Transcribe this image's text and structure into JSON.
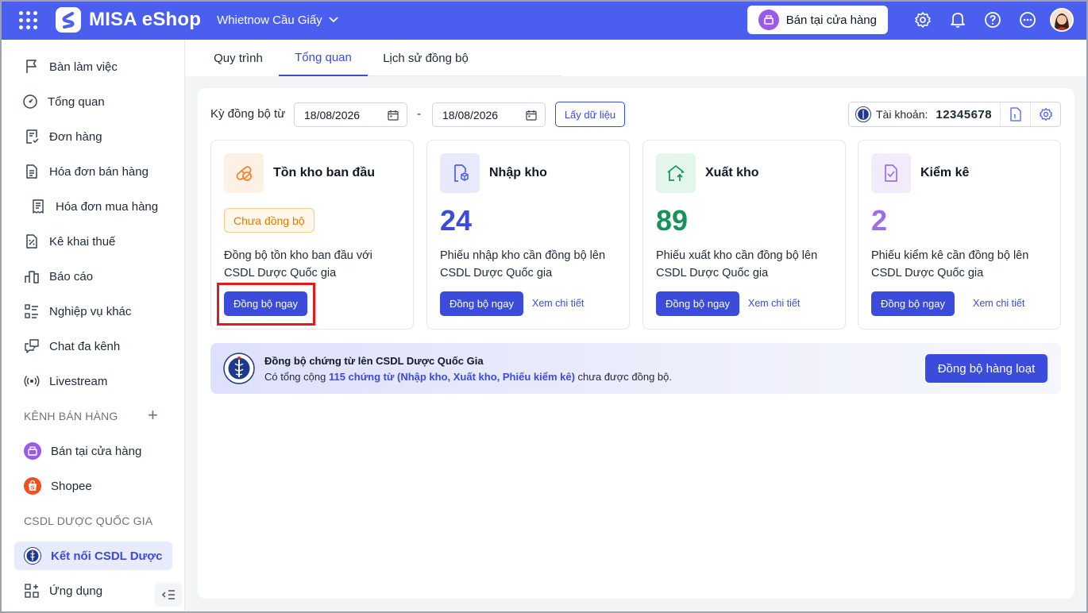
{
  "app": {
    "title": "MISA eShop",
    "store_name": "Whietnow Cầu Giấy",
    "pos_button_label": "Bán tại cửa hàng",
    "brand_color": "#4a5ff0"
  },
  "topbar_icons": [
    "grid-icon",
    "settings-icon",
    "bell-icon",
    "help-icon",
    "more-icon",
    "user-avatar"
  ],
  "sidebar": {
    "items": [
      {
        "label": "Bàn làm việc",
        "icon": "flag-icon"
      },
      {
        "label": "Tổng quan",
        "icon": "gauge-icon"
      },
      {
        "label": "Đơn hàng",
        "icon": "order-icon"
      },
      {
        "label": "Hóa đơn bán hàng",
        "icon": "invoice-icon"
      },
      {
        "label": "Hóa đơn mua hàng",
        "icon": "receipt-icon"
      },
      {
        "label": "Kê khai thuế",
        "icon": "tax-icon"
      },
      {
        "label": "Báo cáo",
        "icon": "report-icon"
      },
      {
        "label": "Nghiệp vụ khác",
        "icon": "list-icon"
      },
      {
        "label": "Chat đa kênh",
        "icon": "chat-icon"
      },
      {
        "label": "Livestream",
        "icon": "livestream-icon"
      }
    ],
    "section_sales": "KÊNH BÁN HÀNG",
    "sales_channels": [
      {
        "label": "Bán tại cửa hàng",
        "icon": "store-icon"
      },
      {
        "label": "Shopee",
        "icon": "shopee-icon"
      }
    ],
    "section_pharma": "CSDL DƯỢC QUỐC GIA",
    "pharma_item": {
      "label": "Kết nối CSDL Dược",
      "icon": "pharma-emblem-icon"
    },
    "apps_item": {
      "label": "Ứng dụng",
      "icon": "apps-icon"
    }
  },
  "tabs": [
    {
      "label": "Quy trình",
      "active": false
    },
    {
      "label": "Tổng quan",
      "active": true
    },
    {
      "label": "Lịch sử đồng bộ",
      "active": false
    }
  ],
  "filter": {
    "label": "Kỳ đồng bộ từ",
    "date_from": "18/08/2026",
    "separator": "-",
    "date_to": "18/08/2026",
    "fetch_label": "Lấy dữ liệu"
  },
  "account": {
    "label": "Tài khoản:",
    "number": "12345678"
  },
  "cards": [
    {
      "title": "Tồn kho ban đầu",
      "badge": "Chưa đồng bộ",
      "description": "Đồng bộ tồn kho ban đầu với CSDL Dược Quốc gia",
      "sync_label": "Đồng bộ ngay",
      "icon_bg": "#fdf1e6",
      "icon_color": "#f0862b"
    },
    {
      "title": "Nhập kho",
      "count": "24",
      "count_color": "#3b4bdc",
      "description": "Phiếu nhập kho cần đồng bộ lên CSDL Dược Quốc gia",
      "sync_label": "Đồng bộ ngay",
      "detail_label": "Xem chi tiết",
      "icon_bg": "#e8eafc",
      "icon_color": "#4a5ff0"
    },
    {
      "title": "Xuất kho",
      "count": "89",
      "count_color": "#14935a",
      "description": "Phiếu xuất kho cần đồng bộ lên CSDL Dược Quốc gia",
      "sync_label": "Đồng bộ ngay",
      "detail_label": "Xem chi tiết",
      "icon_bg": "#e4f5ec",
      "icon_color": "#14935a"
    },
    {
      "title": "Kiểm kê",
      "count": "2",
      "count_color": "#9b6ee8",
      "description": "Phiếu kiểm kê cần đồng bộ lên CSDL Dược Quốc gia",
      "sync_label": "Đồng bộ ngay",
      "detail_label": "Xem chi tiết",
      "icon_bg": "#f1ebfc",
      "icon_color": "#9b6ee8"
    }
  ],
  "banner": {
    "title": "Đồng bộ chứng từ lên CSDL Dược Quốc Gia",
    "text_prefix": "Có tổng cộng",
    "text_highlight": "115 chứng từ (Nhập kho, Xuất kho, Phiếu kiểm kê)",
    "text_suffix": "chưa được đồng bộ.",
    "button_label": "Đồng bộ hàng loạt"
  }
}
